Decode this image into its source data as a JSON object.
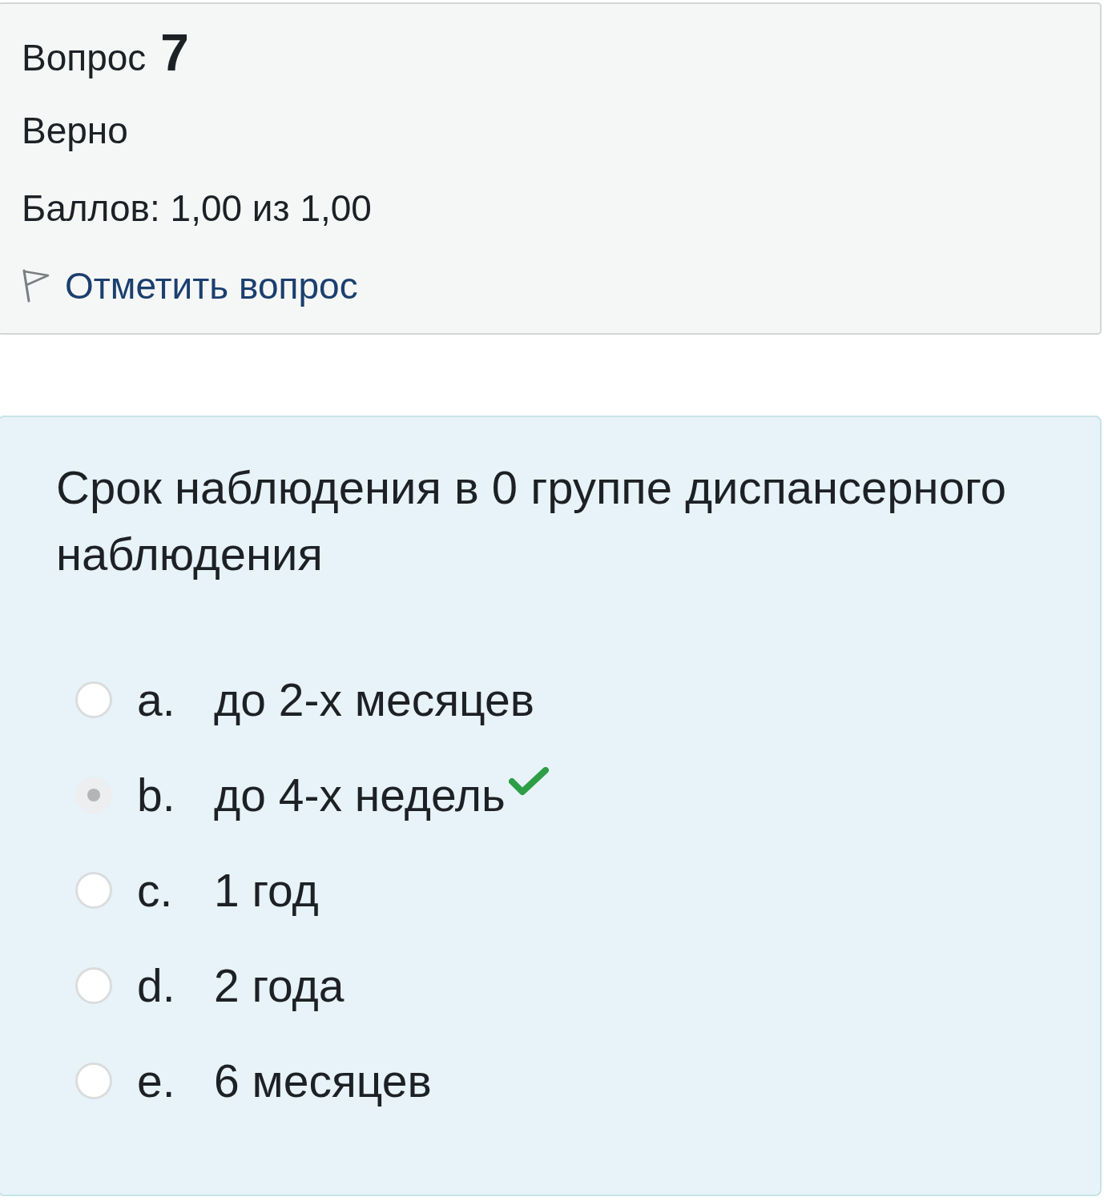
{
  "question_info": {
    "label": "Вопрос",
    "number": "7",
    "state": "Верно",
    "grade": "Баллов: 1,00 из 1,00",
    "flag_link": "Отметить вопрос"
  },
  "question": {
    "text": "Срок наблюдения в 0 группе диспансерного наблюдения",
    "options": [
      {
        "letter": "a.",
        "text": "до 2-х месяцев",
        "selected": false,
        "correct": false
      },
      {
        "letter": "b.",
        "text": "до 4-х недель",
        "selected": true,
        "correct": true
      },
      {
        "letter": "c.",
        "text": "1 год",
        "selected": false,
        "correct": false
      },
      {
        "letter": "d.",
        "text": "2 года",
        "selected": false,
        "correct": false
      },
      {
        "letter": "e.",
        "text": "6 месяцев",
        "selected": false,
        "correct": false
      }
    ]
  }
}
